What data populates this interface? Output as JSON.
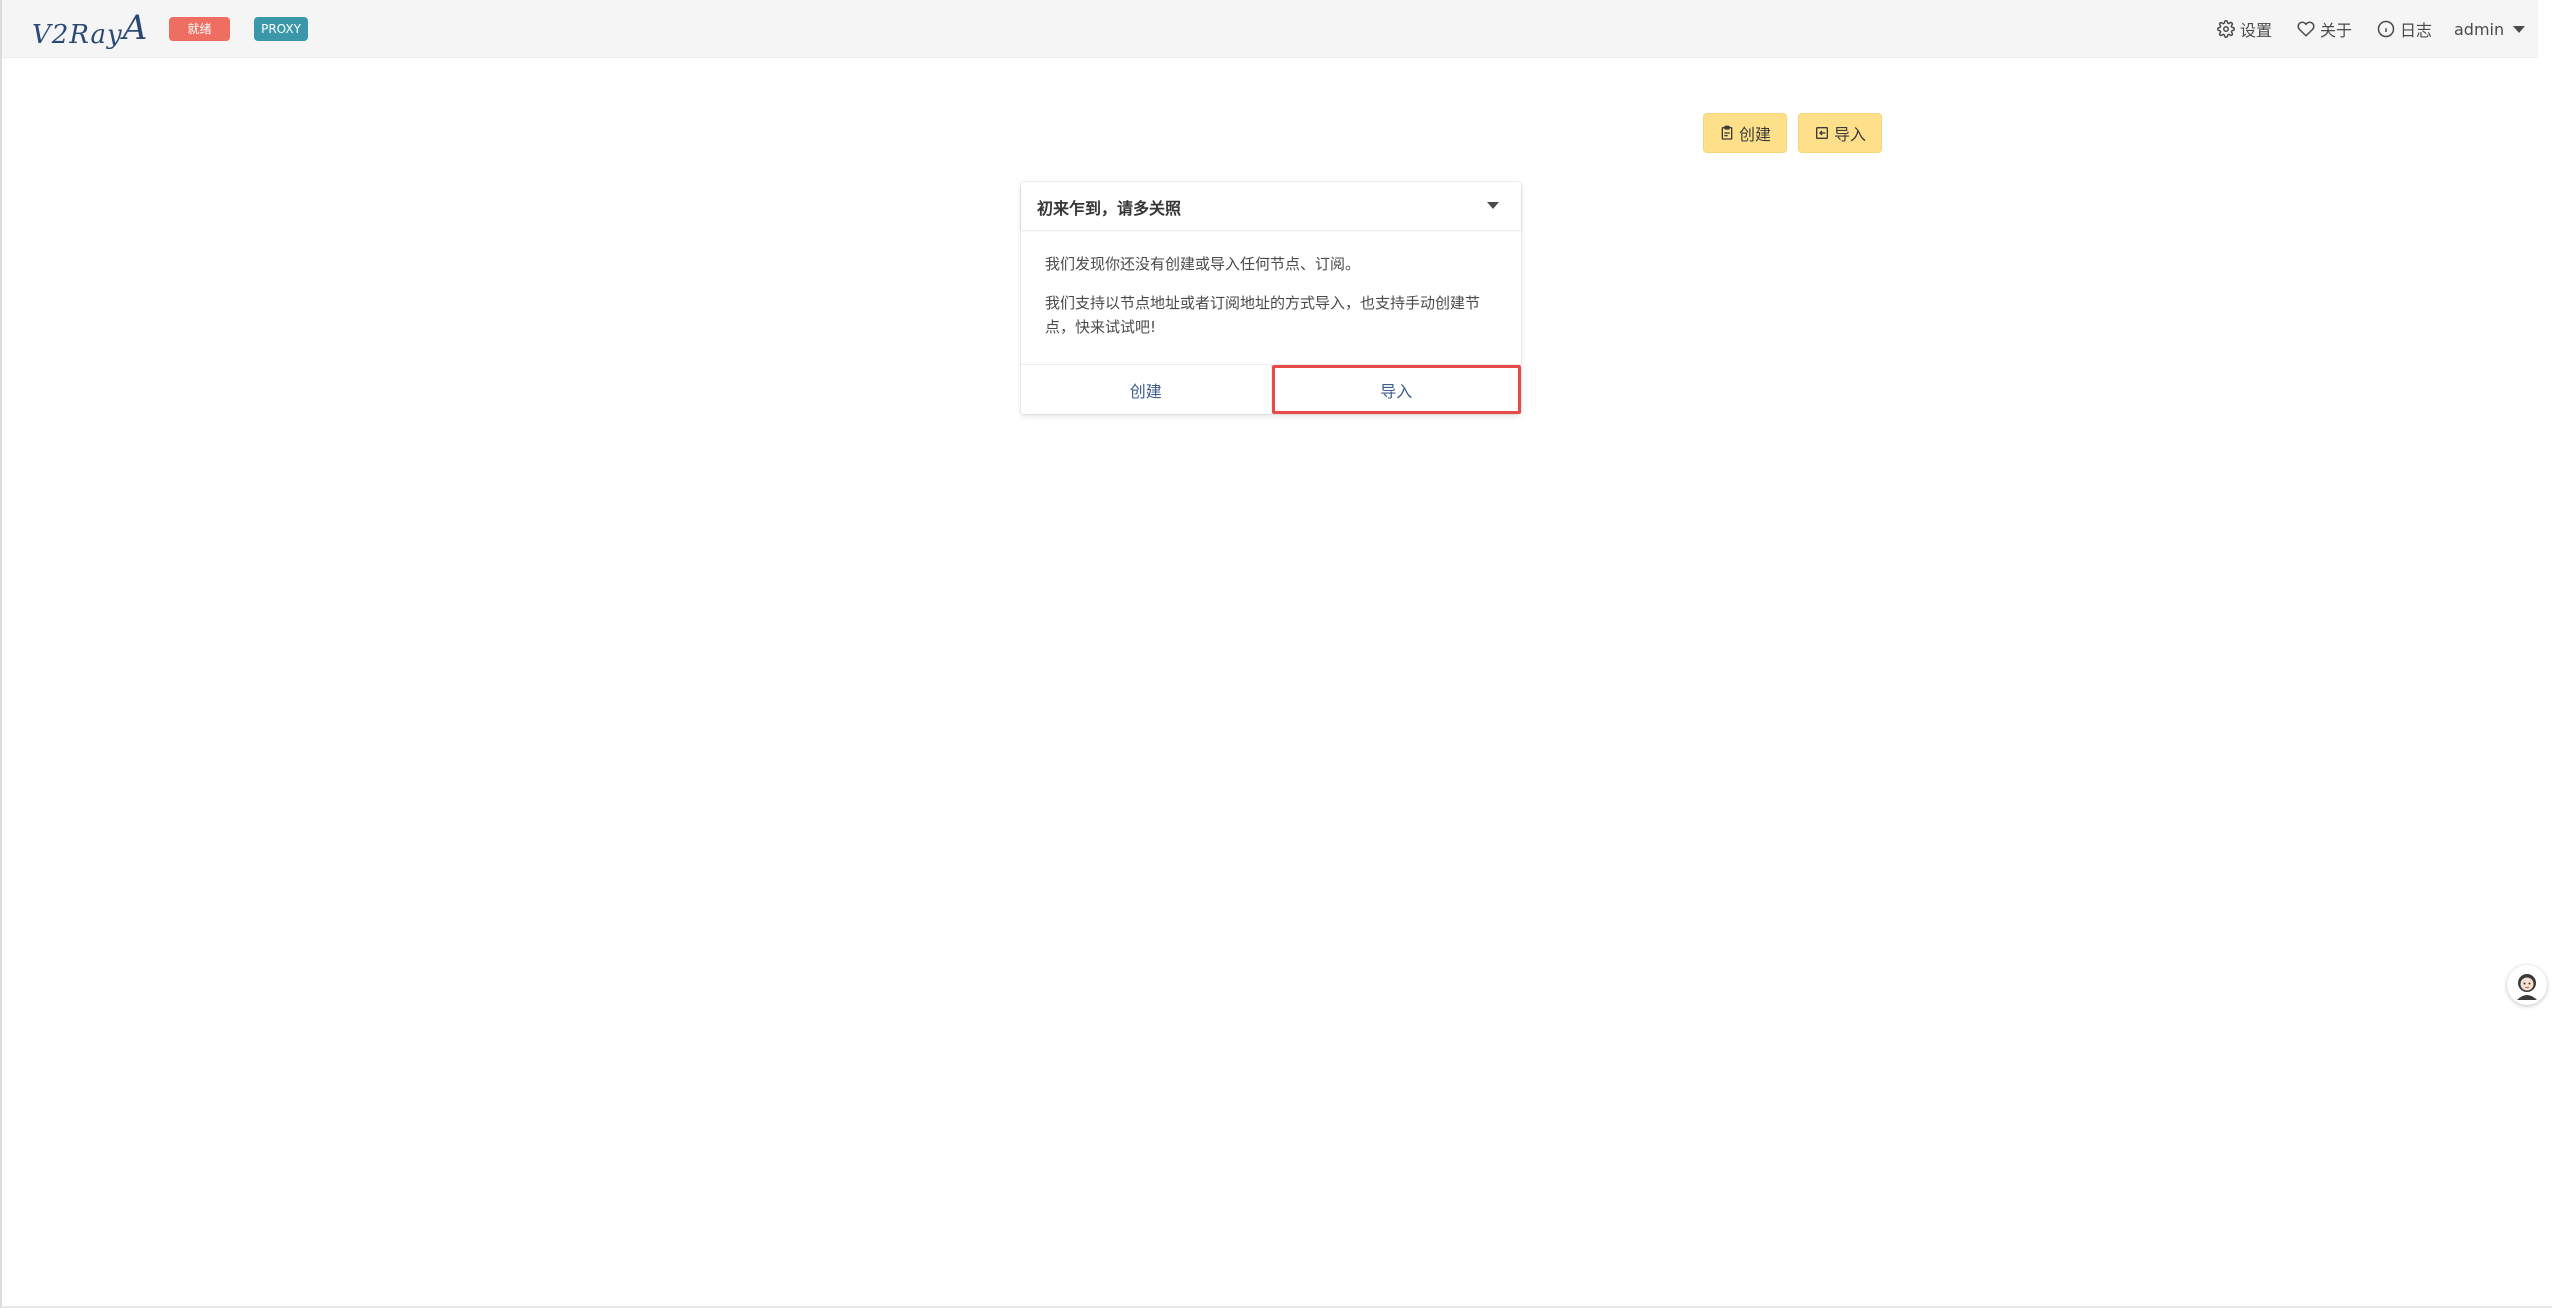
{
  "navbar": {
    "logo": "V2RayA",
    "status_tag": "就绪",
    "proxy_tag": "PROXY",
    "settings_label": "设置",
    "about_label": "关于",
    "log_label": "日志",
    "user_label": "admin"
  },
  "actions": {
    "create_label": "创建",
    "import_label": "导入"
  },
  "welcome_card": {
    "title": "初来乍到，请多关照",
    "paragraph1": "我们发现你还没有创建或导入任何节点、订阅。",
    "paragraph2": "我们支持以节点地址或者订阅地址的方式导入，也支持手动创建节点，快来试试吧!",
    "footer_create": "创建",
    "footer_import": "导入"
  },
  "colors": {
    "status_tag": "#ee6e62",
    "proxy_tag": "#3a98a8",
    "action_button": "#ffe08a",
    "highlight_outline": "#e84a48",
    "link": "#3e5c8e"
  },
  "icons": [
    "gear-icon",
    "heart-icon",
    "info-icon",
    "caret-down-icon",
    "clipboard-icon",
    "import-icon",
    "avatar-icon"
  ]
}
